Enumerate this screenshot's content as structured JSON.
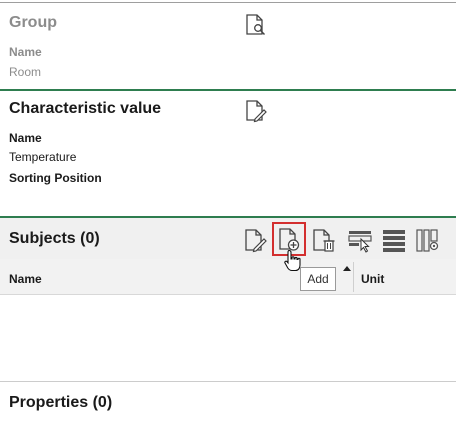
{
  "group": {
    "title": "Group",
    "name_label": "Name",
    "name_value": "Room"
  },
  "characteristic": {
    "title": "Characteristic value",
    "name_label": "Name",
    "name_value": "Temperature",
    "sorting_label": "Sorting Position"
  },
  "subjects": {
    "title": "Subjects (0)",
    "tooltip": "Add",
    "columns": [
      "Name",
      "Unit"
    ]
  },
  "properties": {
    "title": "Properties (0)"
  },
  "colors": {
    "accent_green": "#2e7d4f",
    "highlight_red": "#d32f2f"
  }
}
